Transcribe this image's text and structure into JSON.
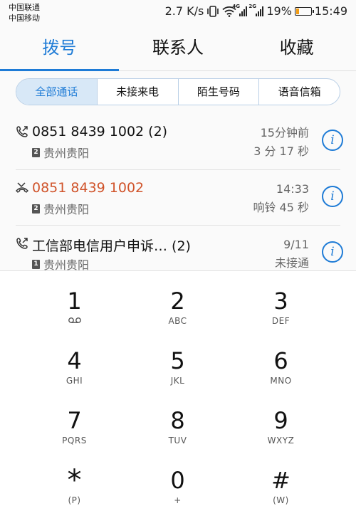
{
  "status_bar": {
    "carrier_1": "中国联通",
    "carrier_2": "中国移动",
    "speed": "2.7 K/s",
    "net_1": "4G",
    "net_2": "2G",
    "battery_text": "19%",
    "battery_level": 0.19,
    "battery_color": "#f39c12",
    "time": "15:49"
  },
  "tabs": [
    {
      "label": "拨号",
      "active": true
    },
    {
      "label": "联系人",
      "active": false
    },
    {
      "label": "收藏",
      "active": false
    }
  ],
  "filters": [
    {
      "label": "全部通话",
      "active": true
    },
    {
      "label": "未接来电",
      "active": false
    },
    {
      "label": "陌生号码",
      "active": false
    },
    {
      "label": "语音信箱",
      "active": false
    }
  ],
  "calls": [
    {
      "number": "0851 8439 1002 (2)",
      "sim": "2",
      "location": "贵州贵阳",
      "time": "15分钟前",
      "detail": "3 分 17 秒",
      "type": "outgoing",
      "missed": false
    },
    {
      "number": "0851 8439 1002",
      "sim": "2",
      "location": "贵州贵阳",
      "time": "14:33",
      "detail": "响铃 45 秒",
      "type": "missed",
      "missed": true
    },
    {
      "number": "工信部电信用户申诉…   (2)",
      "sim": "1",
      "location": "贵州贵阳",
      "time": "9/11",
      "detail": "未接通",
      "type": "outgoing",
      "missed": false
    }
  ],
  "info_glyph": "i",
  "dialpad": [
    {
      "digit": "1",
      "letters": "voicemail-icon"
    },
    {
      "digit": "2",
      "letters": "ABC"
    },
    {
      "digit": "3",
      "letters": "DEF"
    },
    {
      "digit": "4",
      "letters": "GHI"
    },
    {
      "digit": "5",
      "letters": "JKL"
    },
    {
      "digit": "6",
      "letters": "MNO"
    },
    {
      "digit": "7",
      "letters": "PQRS"
    },
    {
      "digit": "8",
      "letters": "TUV"
    },
    {
      "digit": "9",
      "letters": "WXYZ"
    },
    {
      "digit": "*",
      "letters": "(P)"
    },
    {
      "digit": "0",
      "letters": "+"
    },
    {
      "digit": "#",
      "letters": "(W)"
    }
  ],
  "colors": {
    "accent": "#1e7bd6",
    "missed": "#d0532a"
  }
}
